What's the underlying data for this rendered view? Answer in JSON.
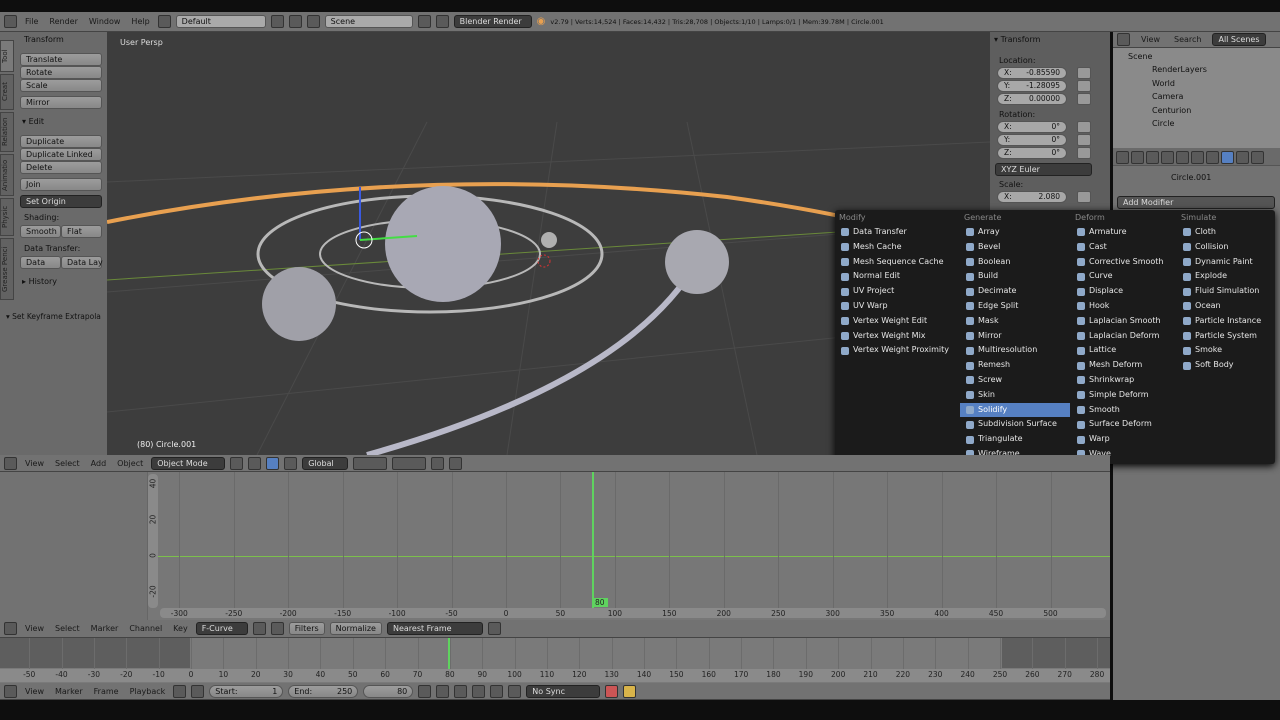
{
  "top_header": {
    "menus": [
      "File",
      "Render",
      "Window",
      "Help"
    ],
    "layout": "Default",
    "scene": "Scene",
    "engine": "Blender Render",
    "stats": "v2.79 | Verts:14,524 | Faces:14,432 | Tris:28,708 | Objects:1/10 | Lamps:0/1 | Mem:39.78M | Circle.001"
  },
  "tool_shelf": {
    "tabs": [
      "Tool",
      "Creat",
      "Relation",
      "Animatio",
      "Physic",
      "Grease Penci"
    ],
    "transform_title": "Transform",
    "translate": "Translate",
    "rotate": "Rotate",
    "scale": "Scale",
    "mirror": "Mirror",
    "edit_title": "Edit",
    "duplicate": "Duplicate",
    "duplicate_linked": "Duplicate Linked",
    "delete": "Delete",
    "join": "Join",
    "set_origin": "Set Origin",
    "shading_label": "Shading:",
    "smooth": "Smooth",
    "flat": "Flat",
    "data_transfer_label": "Data Transfer:",
    "data": "Data",
    "data_lay": "Data Lay",
    "history": "History",
    "operator_panel": "Set Keyframe Extrapola"
  },
  "viewport": {
    "view_label": "User Persp",
    "object_label": "(80) Circle.001"
  },
  "n_panel": {
    "title": "Transform",
    "location_label": "Location:",
    "location": [
      {
        "axis": "X:",
        "value": "-0.85590"
      },
      {
        "axis": "Y:",
        "value": "-1.28095"
      },
      {
        "axis": "Z:",
        "value": "0.00000"
      }
    ],
    "rotation_label": "Rotation:",
    "rotation": [
      {
        "axis": "X:",
        "value": "0°"
      },
      {
        "axis": "Y:",
        "value": "0°"
      },
      {
        "axis": "Z:",
        "value": "0°"
      }
    ],
    "rotation_mode": "XYZ Euler",
    "scale_label": "Scale:",
    "scale_x": {
      "axis": "X:",
      "value": "2.080"
    }
  },
  "outliner": {
    "tabs": [
      "View",
      "Search",
      "All Scenes"
    ],
    "items": [
      "Scene",
      "RenderLayers",
      "World",
      "Camera",
      "Centurion",
      "Circle"
    ]
  },
  "properties": {
    "object_name": "Circle.001",
    "add_modifier": "Add Modifier"
  },
  "modifier_menu": {
    "columns": [
      {
        "title": "Modify",
        "items": [
          "Data Transfer",
          "Mesh Cache",
          "Mesh Sequence Cache",
          "Normal Edit",
          "UV Project",
          "UV Warp",
          "Vertex Weight Edit",
          "Vertex Weight Mix",
          "Vertex Weight Proximity"
        ]
      },
      {
        "title": "Generate",
        "items": [
          "Array",
          "Bevel",
          "Boolean",
          "Build",
          "Decimate",
          "Edge Split",
          "Mask",
          "Mirror",
          "Multiresolution",
          "Remesh",
          "Screw",
          "Skin",
          "Solidify",
          "Subdivision Surface",
          "Triangulate",
          "Wireframe"
        ]
      },
      {
        "title": "Deform",
        "items": [
          "Armature",
          "Cast",
          "Corrective Smooth",
          "Curve",
          "Displace",
          "Hook",
          "Laplacian Smooth",
          "Laplacian Deform",
          "Lattice",
          "Mesh Deform",
          "Shrinkwrap",
          "Simple Deform",
          "Smooth",
          "Surface Deform",
          "Warp",
          "Wave"
        ]
      },
      {
        "title": "Simulate",
        "items": [
          "Cloth",
          "Collision",
          "Dynamic Paint",
          "Explode",
          "Fluid Simulation",
          "Ocean",
          "Particle Instance",
          "Particle System",
          "Smoke",
          "Soft Body"
        ]
      }
    ],
    "highlighted": "Solidify"
  },
  "view3d_header": {
    "menus": [
      "View",
      "Select",
      "Add",
      "Object"
    ],
    "mode": "Object Mode",
    "orientation": "Global"
  },
  "graph_editor": {
    "x_ticks": [
      "-300",
      "-250",
      "-200",
      "-150",
      "-100",
      "-50",
      "0",
      "50",
      "100",
      "150",
      "200",
      "250",
      "300",
      "350",
      "400",
      "450",
      "500"
    ],
    "y_ticks": [
      "40",
      "20",
      "0",
      "-20"
    ],
    "current_frame": "80"
  },
  "graph_header": {
    "menus": [
      "View",
      "Select",
      "Marker",
      "Channel",
      "Key"
    ],
    "mode": "F-Curve",
    "filters": "Filters",
    "normalize": "Normalize",
    "snap": "Nearest Frame"
  },
  "timeline": {
    "ticks": [
      "-50",
      "-40",
      "-30",
      "-20",
      "-10",
      "0",
      "10",
      "20",
      "30",
      "40",
      "50",
      "60",
      "70",
      "80",
      "90",
      "100",
      "110",
      "120",
      "130",
      "140",
      "150",
      "160",
      "170",
      "180",
      "190",
      "200",
      "210",
      "220",
      "230",
      "240",
      "250",
      "260",
      "270",
      "280"
    ],
    "menus": [
      "View",
      "Marker",
      "Frame",
      "Playback"
    ],
    "start_label": "Start:",
    "start": "1",
    "end_label": "End:",
    "end": "250",
    "current": "80",
    "sync": "No Sync"
  },
  "colors": {
    "accent": "#5680c2",
    "viewport_bg": "#3d3d3d",
    "header": "#727272",
    "playhead": "#5fd35f",
    "selection_orange": "#e8a050"
  }
}
